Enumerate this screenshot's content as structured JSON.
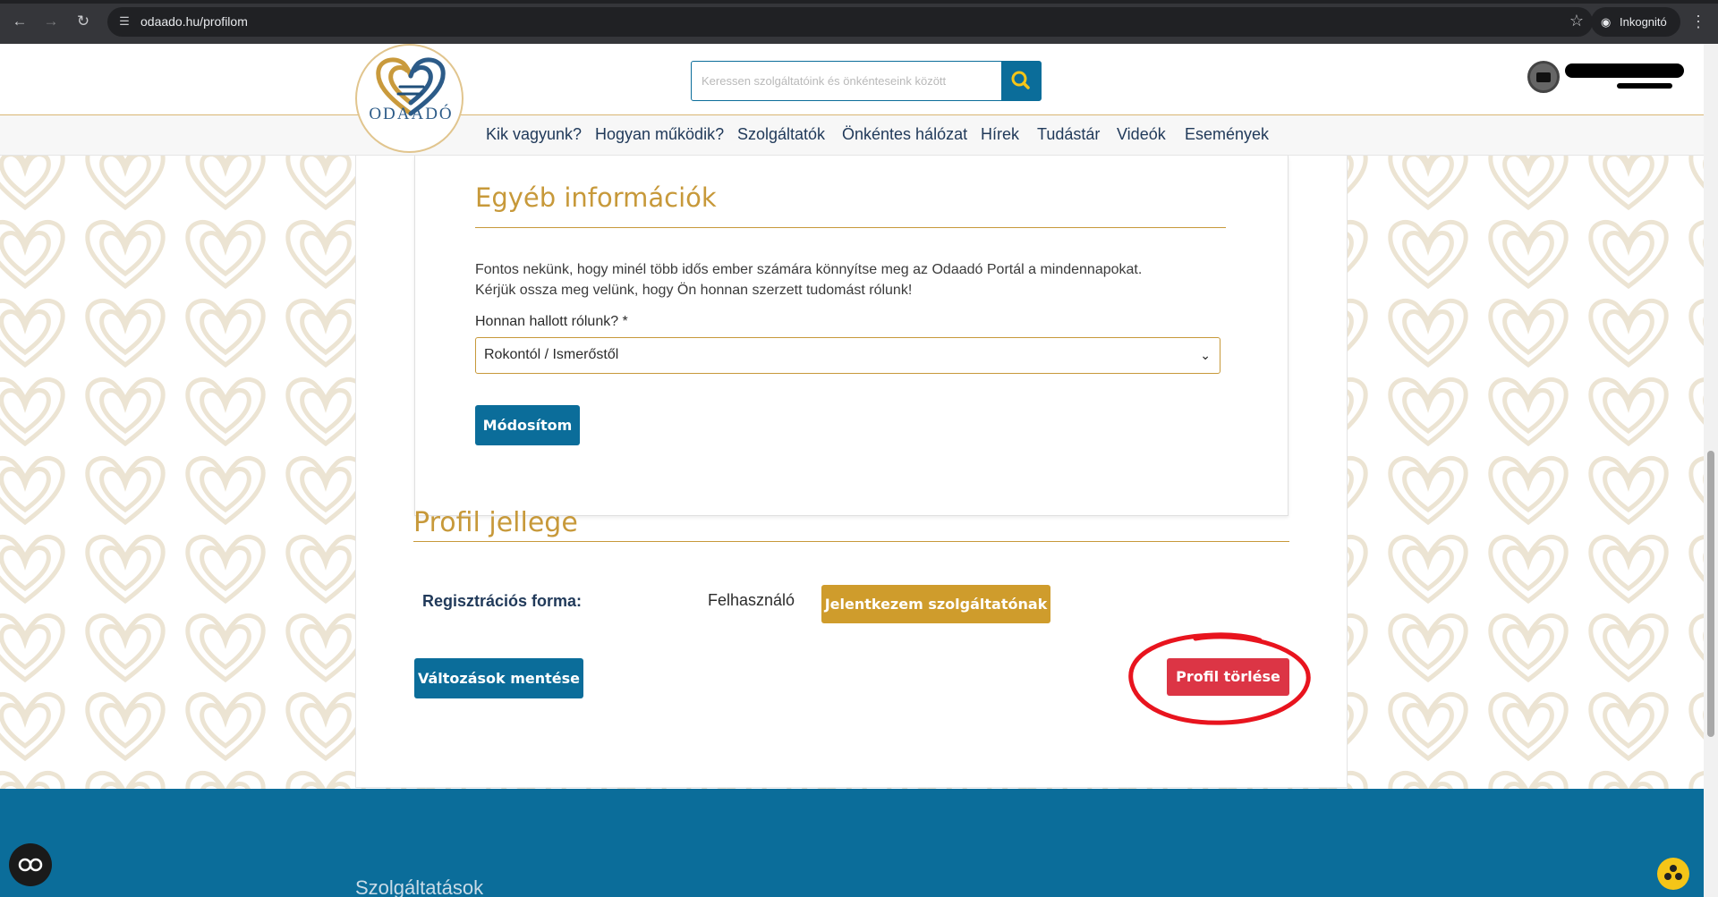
{
  "browser": {
    "url": "odaado.hu/profilom",
    "incognito_label": "Inkognitó"
  },
  "header": {
    "logo_text": "ODAADÓ",
    "search_placeholder": "Keressen szolgáltatóink és önkénteseink között"
  },
  "nav": {
    "items": [
      "Kik vagyunk?",
      "Hogyan működik?",
      "Szolgáltatók",
      "Önkéntes hálózat",
      "Hírek",
      "Tudástár",
      "Videók",
      "Események"
    ]
  },
  "other_info": {
    "title": "Egyéb információk",
    "text_line1": "Fontos nekünk, hogy minél több idős ember számára könnyítse meg az Odaadó Portál a mindennapokat.",
    "text_line2": "Kérjük ossza meg velünk, hogy Ön honnan szerzett tudomást rólunk!",
    "field_label": "Honnan hallott rólunk? *",
    "selected": "Rokontól / Ismerőstől",
    "submit_label": "Módosítom"
  },
  "profile_type": {
    "title": "Profil jellege",
    "reg_label": "Regisztrációs forma:",
    "reg_value": "Felhasználó",
    "apply_label": "Jelentkezem szolgáltatónak",
    "save_label": "Változások mentése",
    "delete_label": "Profil törlése"
  },
  "footer": {
    "heading": "Szolgáltatások"
  },
  "colors": {
    "brand_blue": "#0b6d9a",
    "gold": "#c7993a",
    "danger": "#dc3545",
    "annotation": "#e8141e"
  }
}
